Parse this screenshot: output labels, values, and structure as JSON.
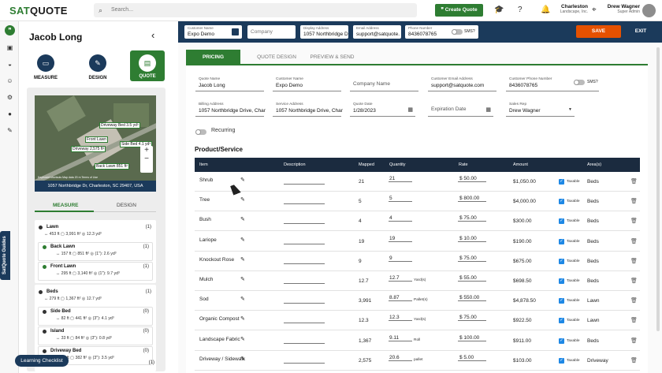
{
  "app": {
    "logo_a": "SAT",
    "logo_b": "QUOTE"
  },
  "topbar": {
    "search_placeholder": "Search...",
    "create_quote": "❞ Create Quote",
    "location_name": "Charleston",
    "location_sub": "Landscape, Inc.",
    "user_name": "Drew Wagner",
    "user_role": "Super Admin"
  },
  "guides_tab": "SatQuote Guides",
  "learning_checklist": "Learning Checklist",
  "left_panel": {
    "customer": "Jacob Long",
    "modes": [
      {
        "label": "MEASURE"
      },
      {
        "label": "DESIGN"
      },
      {
        "label": "QUOTE"
      }
    ],
    "map_labels": [
      "Driveway Bed 3.5 yd³",
      "Front Lawn",
      "Side Bed 4.1 yd³",
      "Driveway 2,575 ft²",
      "Back Lawn 851 ft²"
    ],
    "map_footer": [
      "Keyboard shortcuts",
      "Map data",
      "20 m",
      "Terms of Use"
    ],
    "address": "1057 Northbridge Dr, Charleston, SC 29407, USA",
    "tabs": {
      "measure": "MEASURE",
      "design": "DESIGN"
    },
    "areas": [
      {
        "name": "Lawn",
        "count": "(1)",
        "measures": "↔ 453 ft  ▢ 3,991 ft²  ◎ 12.3 yd³"
      },
      {
        "name": "Back Lawn",
        "count": "(1)",
        "measures": "↔ 157 ft  ▢ 851 ft²  ◎ (1\"): 2.6 yd³"
      },
      {
        "name": "Front Lawn",
        "count": "(1)",
        "measures": "↔ 295 ft  ▢ 3,140 ft²  ◎ (1\"): 9.7 yd³"
      },
      {
        "name": "Beds",
        "count": "(1)",
        "measures": "↔ 279 ft  ▢ 1,367 ft²  ◎ 12.7 yd³"
      },
      {
        "name": "Side Bed",
        "count": "(0)",
        "measures": "↔ 82 ft  ▢ 441 ft²  ◎ (3\"): 4.1 yd³"
      },
      {
        "name": "Island",
        "count": "(0)",
        "measures": "↔ 33 ft  ▢ 84 ft²  ◎ (3\"): 0.8 yd³"
      },
      {
        "name": "Driveway Bed",
        "count": "(0)",
        "measures": "↔ 70 ft  ▢ 382 ft²  ◎ (3\"): 3.5 yd³"
      },
      {
        "name": "",
        "count": "(1)",
        "measures": ""
      }
    ]
  },
  "header": {
    "customer_name_label": "Customer Name",
    "customer_name": "Expo Demo",
    "company_placeholder": "Company",
    "display_address_label": "Display Address",
    "display_address": "1057 Northbridge D",
    "email_label": "Email Address",
    "email": "support@satquote.",
    "phone_label": "Phone Number",
    "phone": "8436078765",
    "sms": "SMS?",
    "save": "SAVE",
    "exit": "EXIT"
  },
  "tabs": [
    "PRICING",
    "QUOTE DESIGN",
    "PREVIEW & SEND"
  ],
  "form": {
    "quote_name_label": "Quote Name",
    "quote_name": "Jacob Long",
    "customer_name_label": "Customer Name",
    "customer_name": "Expo Demo",
    "company_placeholder": "Company Name",
    "email_label": "Customer Email Address",
    "email": "support@satquote.com",
    "phone_label": "Customer Phone Number",
    "phone": "8436078765",
    "sms": "SMS?",
    "billing_label": "Billing Address",
    "billing": "1057 Northbridge Drive, Char",
    "service_label": "Service Address",
    "service": "1057 Northbridge Drive, Char",
    "quote_date_label": "Quote Date",
    "quote_date": "1/28/2023",
    "expiration_placeholder": "Expiration Date",
    "sales_rep_label": "Sales Rep",
    "sales_rep": "Drew Wagner",
    "recurring": "Recurring"
  },
  "products": {
    "title": "Product/Service",
    "columns": [
      "Item",
      "Description",
      "Mapped",
      "Quantity",
      "Rate",
      "Amount",
      "Area(s)"
    ],
    "rows": [
      {
        "item": "Shrub",
        "mapped": "21",
        "qty": "21",
        "unit": "",
        "rate": "$ 50.00",
        "amount": "$1,050.00",
        "taxable": "Taxable",
        "area": "Beds"
      },
      {
        "item": "Tree",
        "mapped": "5",
        "qty": "5",
        "unit": "",
        "rate": "$ 800.00",
        "amount": "$4,000.00",
        "taxable": "Taxable",
        "area": "Beds"
      },
      {
        "item": "Bush",
        "mapped": "4",
        "qty": "4",
        "unit": "",
        "rate": "$ 75.00",
        "amount": "$300.00",
        "taxable": "Taxable",
        "area": "Beds"
      },
      {
        "item": "Lariope",
        "mapped": "19",
        "qty": "19",
        "unit": "",
        "rate": "$ 10.00",
        "amount": "$190.00",
        "taxable": "Taxable",
        "area": "Beds"
      },
      {
        "item": "Knockout Rose",
        "mapped": "9",
        "qty": "9",
        "unit": "",
        "rate": "$ 75.00",
        "amount": "$675.00",
        "taxable": "Taxable",
        "area": "Beds"
      },
      {
        "item": "Mulch",
        "mapped": "12.7",
        "qty": "12.7",
        "unit": "Yard(s)",
        "rate": "$ 55.00",
        "amount": "$698.50",
        "taxable": "Taxable",
        "area": "Beds"
      },
      {
        "item": "Sod",
        "mapped": "3,991",
        "qty": "8.87",
        "unit": "Pallet(s)",
        "rate": "$ 550.00",
        "amount": "$4,878.50",
        "taxable": "Taxable",
        "area": "Lawn"
      },
      {
        "item": "Organic Compost",
        "mapped": "12.3",
        "qty": "12.3",
        "unit": "Yard(s)",
        "rate": "$ 75.00",
        "amount": "$922.50",
        "taxable": "Taxable",
        "area": "Lawn"
      },
      {
        "item": "Landscape Fabric",
        "mapped": "1,367",
        "qty": "9.11",
        "unit": "Roll",
        "rate": "$ 100.00",
        "amount": "$911.00",
        "taxable": "Taxable",
        "area": "Beds"
      },
      {
        "item": "Driveway / Sidewalk",
        "mapped": "2,575",
        "qty": "20.6",
        "unit": "pallet",
        "rate": "$ 5.00",
        "amount": "$103.00",
        "taxable": "Taxable",
        "area": "Driveway"
      }
    ]
  }
}
